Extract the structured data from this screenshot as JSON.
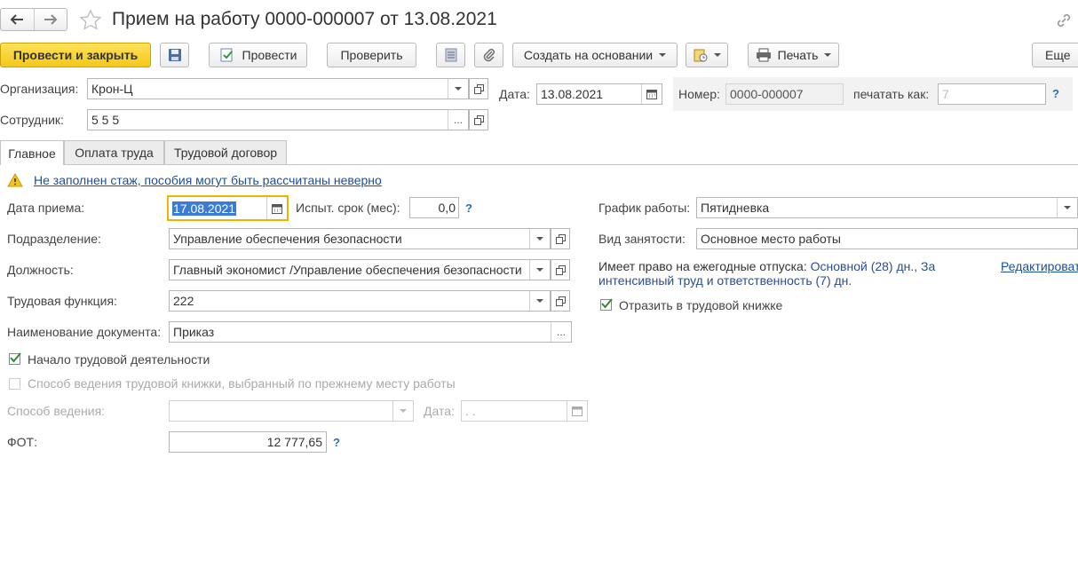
{
  "window": {
    "title": "Прием на работу 0000-000007 от 13.08.2021"
  },
  "toolbar": {
    "post_close": "Провести и закрыть",
    "post": "Провести",
    "check": "Проверить",
    "create_based": "Создать на основании",
    "print": "Печать",
    "more": "Еще"
  },
  "header": {
    "org_label": "Организация:",
    "org_value": "Крон-Ц",
    "date_label": "Дата:",
    "date_value": "13.08.2021",
    "number_label": "Номер:",
    "number_value": "0000-000007",
    "print_as_label": "печатать как:",
    "print_as_placeholder": "7",
    "employee_label": "Сотрудник:",
    "employee_value": "5 5 5"
  },
  "tabs": [
    {
      "label": "Главное"
    },
    {
      "label": "Оплата труда"
    },
    {
      "label": "Трудовой договор"
    }
  ],
  "main": {
    "warning": "Не заполнен стаж, пособия могут быть рассчитаны неверно",
    "hire_date_label": "Дата приема:",
    "hire_date_value": "17.08.2021",
    "probation_label": "Испыт. срок (мес):",
    "probation_value": "0,0",
    "dept_label": "Подразделение:",
    "dept_value": "Управление обеспечения безопасности",
    "position_label": "Должность:",
    "position_value": "Главный экономист /Управление обеспечения безопасности",
    "function_label": "Трудовая функция:",
    "function_value": "222",
    "docname_label": "Наименование документа:",
    "docname_value": "Приказ",
    "start_work_label": "Начало трудовой деятельности",
    "book_method_label": "Способ ведения трудовой книжки, выбранный по прежнему месту работы",
    "method_label": "Способ ведения:",
    "method_date_label": "Дата:",
    "method_date_value": " .  .",
    "fot_label": "ФОТ:",
    "fot_value": "12 777,65",
    "schedule_label": "График работы:",
    "schedule_value": "Пятидневка",
    "employment_label": "Вид занятости:",
    "employment_value": "Основное место работы",
    "vacation_label": "Имеет право на ежегодные отпуска:",
    "vacation_value_1": "Основной (28) дн., За",
    "vacation_value_2": "интенсивный труд и ответственность (7) дн.",
    "edit_link": "Редактировать",
    "workbook_label": "Отразить в трудовой книжке",
    "q_mark": "?"
  },
  "colors": {
    "primary_button": "#f4c81a",
    "link": "#2a6db5",
    "focus_border": "#f0b400",
    "selection": "#3a7bd5"
  }
}
